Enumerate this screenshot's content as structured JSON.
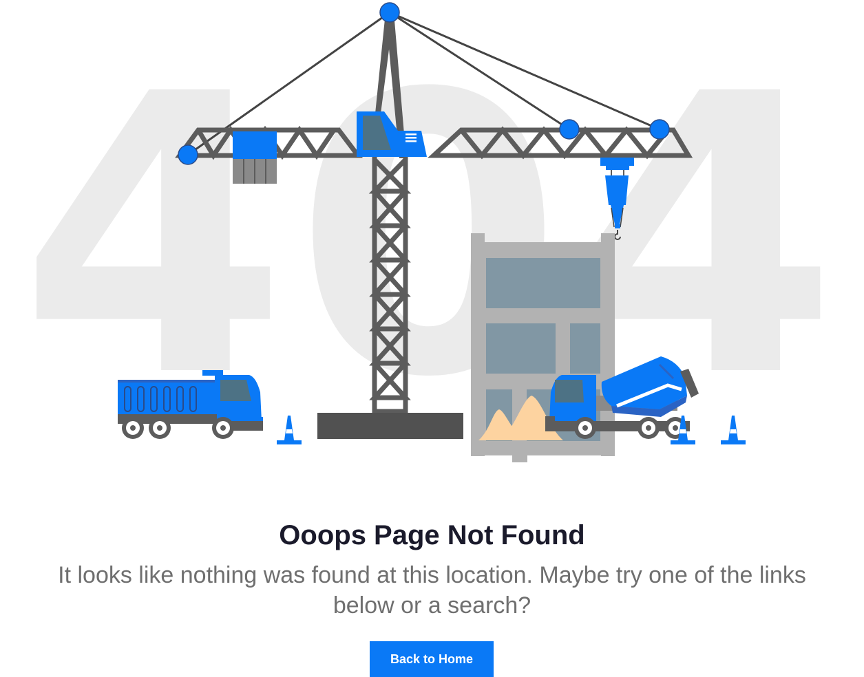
{
  "illustration": {
    "background_text": "404",
    "colors": {
      "accent": "#0a79f6",
      "steel": "#5c5c5c",
      "building": "#b2b2b2",
      "window": "#8197a4",
      "sand": "#fdd3a0",
      "cab_window": "#4d7285"
    }
  },
  "error": {
    "title": "Ooops Page Not Found",
    "message": "It looks like nothing was found at this location. Maybe try one of the links below or a search?"
  },
  "actions": {
    "home_label": "Back to Home"
  }
}
